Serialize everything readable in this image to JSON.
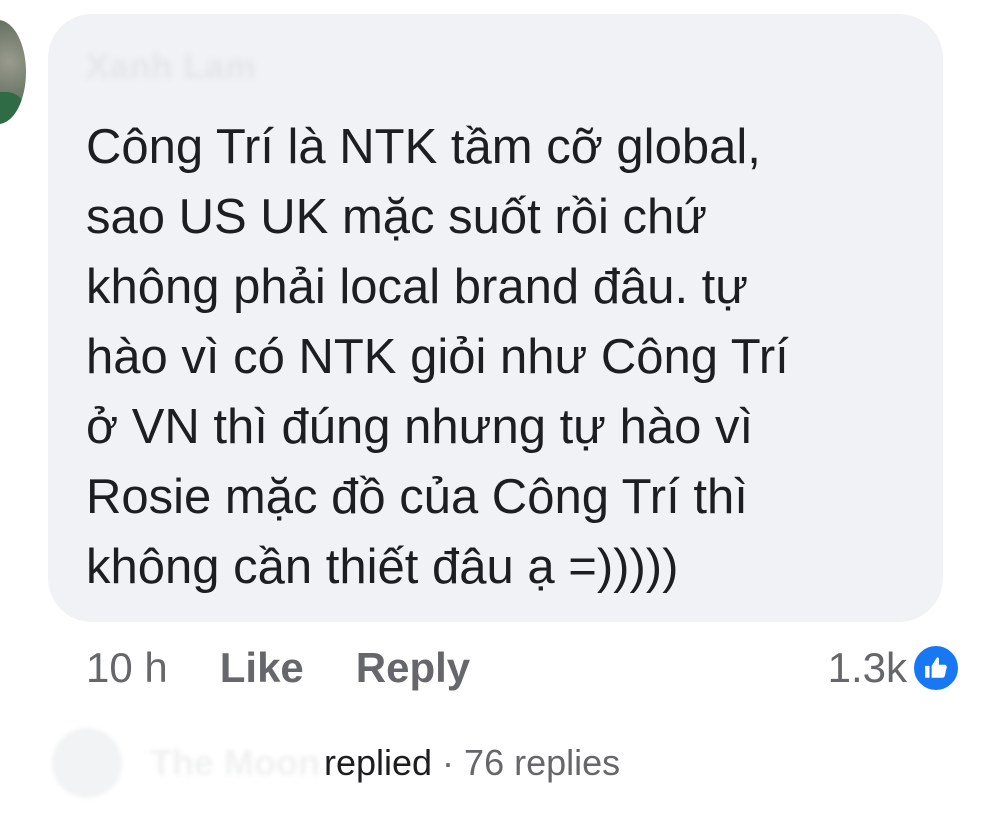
{
  "comment": {
    "author": "Xanh Lam",
    "lines": [
      "Công Trí là NTK tầm cỡ global,",
      "sao US UK mặc suốt rồi chứ",
      "không phải local brand đâu. tự",
      "hào vì có NTK giỏi như Công Trí",
      "ở VN thì đúng nhưng tự hào vì",
      "Rosie mặc đồ của Công Trí thì",
      "không cần thiết đâu ạ =)))))"
    ]
  },
  "actions": {
    "time": "10 h",
    "like_label": "Like",
    "reply_label": "Reply"
  },
  "reactions": {
    "count": "1.3k",
    "icon": "like-thumb-icon",
    "color": "#1877f2"
  },
  "replies": {
    "author": "The Moon",
    "verb": "replied",
    "separator": "·",
    "count_text": "76 replies"
  }
}
